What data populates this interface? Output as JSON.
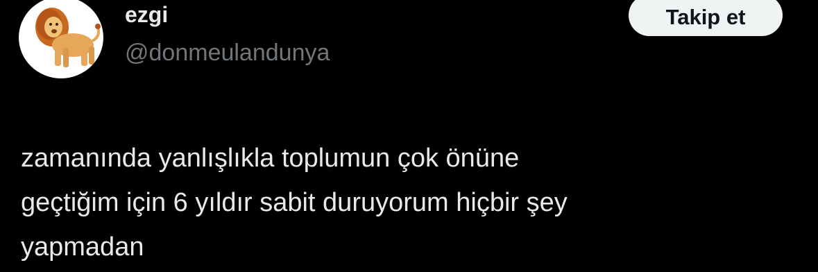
{
  "author": {
    "display_name": "ezgi",
    "handle": "@donmeulandunya",
    "avatar_icon": "lion-avatar-icon"
  },
  "actions": {
    "follow_label": "Takip et"
  },
  "tweet": {
    "lines": [
      "zamanında yanlışlıkla toplumun çok önüne",
      "geçtiğim için 6 yıldır sabit duruyorum hiçbir şey",
      "yapmadan"
    ]
  },
  "colors": {
    "background": "#000000",
    "text_primary": "#e7e9ea",
    "text_secondary": "#71767b",
    "button_bg": "#eff3f4",
    "button_text": "#0f1419"
  }
}
